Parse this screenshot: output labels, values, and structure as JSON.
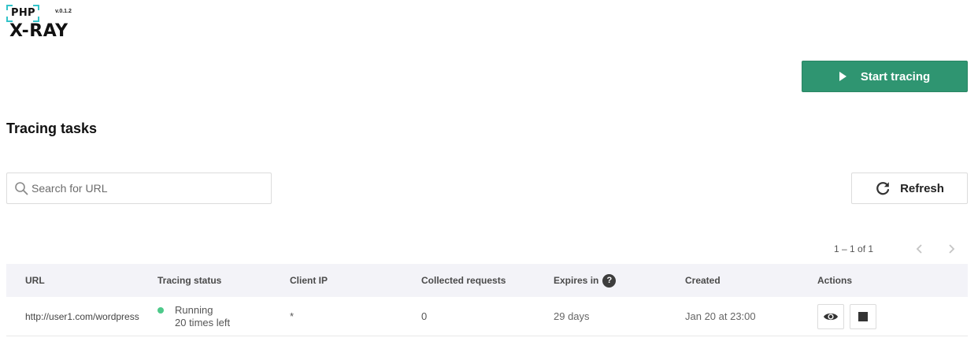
{
  "app": {
    "logo_php": "PHP",
    "logo_name": "X-RAY",
    "version": "v.0.1.2",
    "brand_color": "#2f9571",
    "accent_cyan": "#33c3c9"
  },
  "header": {
    "start_button_label": "Start tracing",
    "start_button_icon": "play-icon"
  },
  "main": {
    "title": "Tracing tasks",
    "search": {
      "placeholder": "Search for URL",
      "value": "",
      "icon": "search-icon"
    },
    "refresh_label": "Refresh",
    "refresh_icon": "refresh-icon",
    "pagination": {
      "range": "1 – 1 of 1",
      "prev_icon": "chevron-left-icon",
      "next_icon": "chevron-right-icon"
    }
  },
  "table": {
    "columns": {
      "url": "URL",
      "status": "Tracing status",
      "client_ip": "Client IP",
      "collected": "Collected requests",
      "expires": "Expires in",
      "created": "Created",
      "actions": "Actions"
    },
    "expires_help_icon": "?",
    "rows": [
      {
        "url": "http://user1.com/wordpress",
        "status": "Running",
        "status_detail": "20 times left",
        "status_color": "#4dc98a",
        "client_ip": "*",
        "collected": "0",
        "expires": "29 days",
        "created": "Jan 20 at 23:00",
        "actions": [
          "eye-icon",
          "stop-icon"
        ]
      }
    ]
  }
}
